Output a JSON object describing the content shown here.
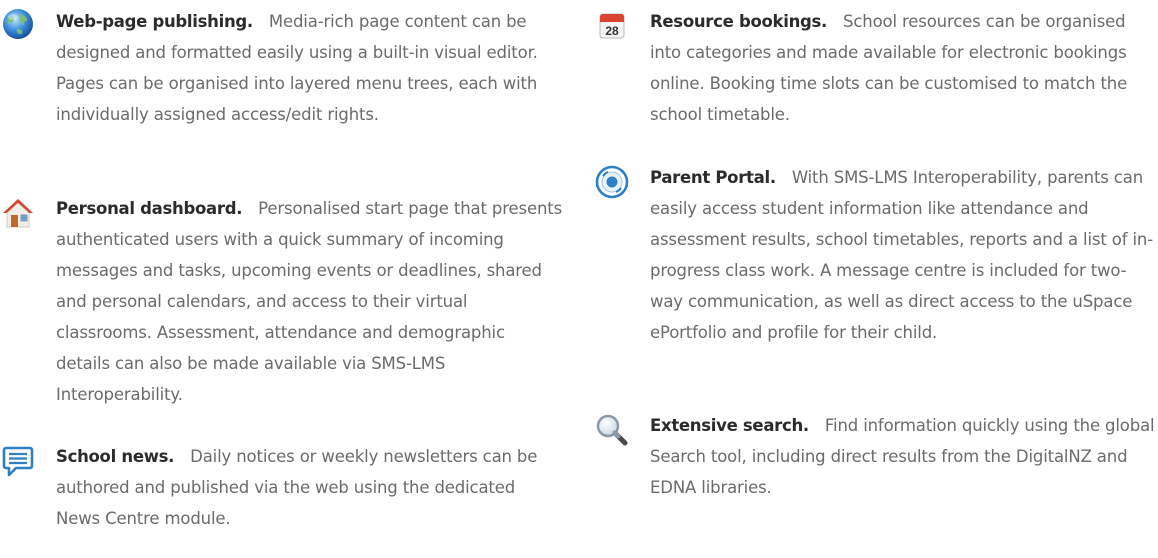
{
  "features_left": [
    {
      "id": "web-page-publishing",
      "icon": "globe-icon",
      "title": "Web-page publishing.",
      "body": "Media-rich page content can be designed and formatted easily using a built-in visual editor. Pages can be organised into layered menu trees, each with individually assigned access/edit rights."
    },
    {
      "id": "personal-dashboard",
      "icon": "home-icon",
      "title": "Personal dashboard.",
      "body": "Personalised start page that presents authenticated users with a quick summary of incoming messages and tasks, upcoming events or deadlines, shared and personal calendars, and access to their virtual classrooms. Assessment, attendance and demographic details can also be made available via SMS-LMS Interoperability."
    },
    {
      "id": "school-news",
      "icon": "speech-bubble-icon",
      "title": "School news.",
      "body": "Daily notices or weekly newsletters can be authored and published via the web using the dedicated News Centre module."
    }
  ],
  "features_right": [
    {
      "id": "resource-bookings",
      "icon": "calendar-icon",
      "icon_text": "28",
      "title": "Resource bookings.",
      "body": "School resources can be organised into categories and made available for electronic bookings online. Booking time slots can be customised to match the school timetable."
    },
    {
      "id": "parent-portal",
      "icon": "portal-icon",
      "title": "Parent Portal.",
      "body": "With SMS-LMS Interoperability, parents can easily access student information like attendance and assessment results, school timetables, reports and a list of in-progress class work. A message centre is included for two-way communication, as well as direct access to the uSpace ePortfolio and profile for their child."
    },
    {
      "id": "extensive-search",
      "icon": "magnifier-icon",
      "title": "Extensive search.",
      "body": "Find information quickly using the global Search tool, including direct results from the DigitalNZ and EDNA libraries."
    }
  ],
  "colors": {
    "title": "#2b2b2b",
    "body": "#6b6b6b",
    "accent_blue": "#2f7fc4",
    "accent_red": "#d9432f"
  }
}
